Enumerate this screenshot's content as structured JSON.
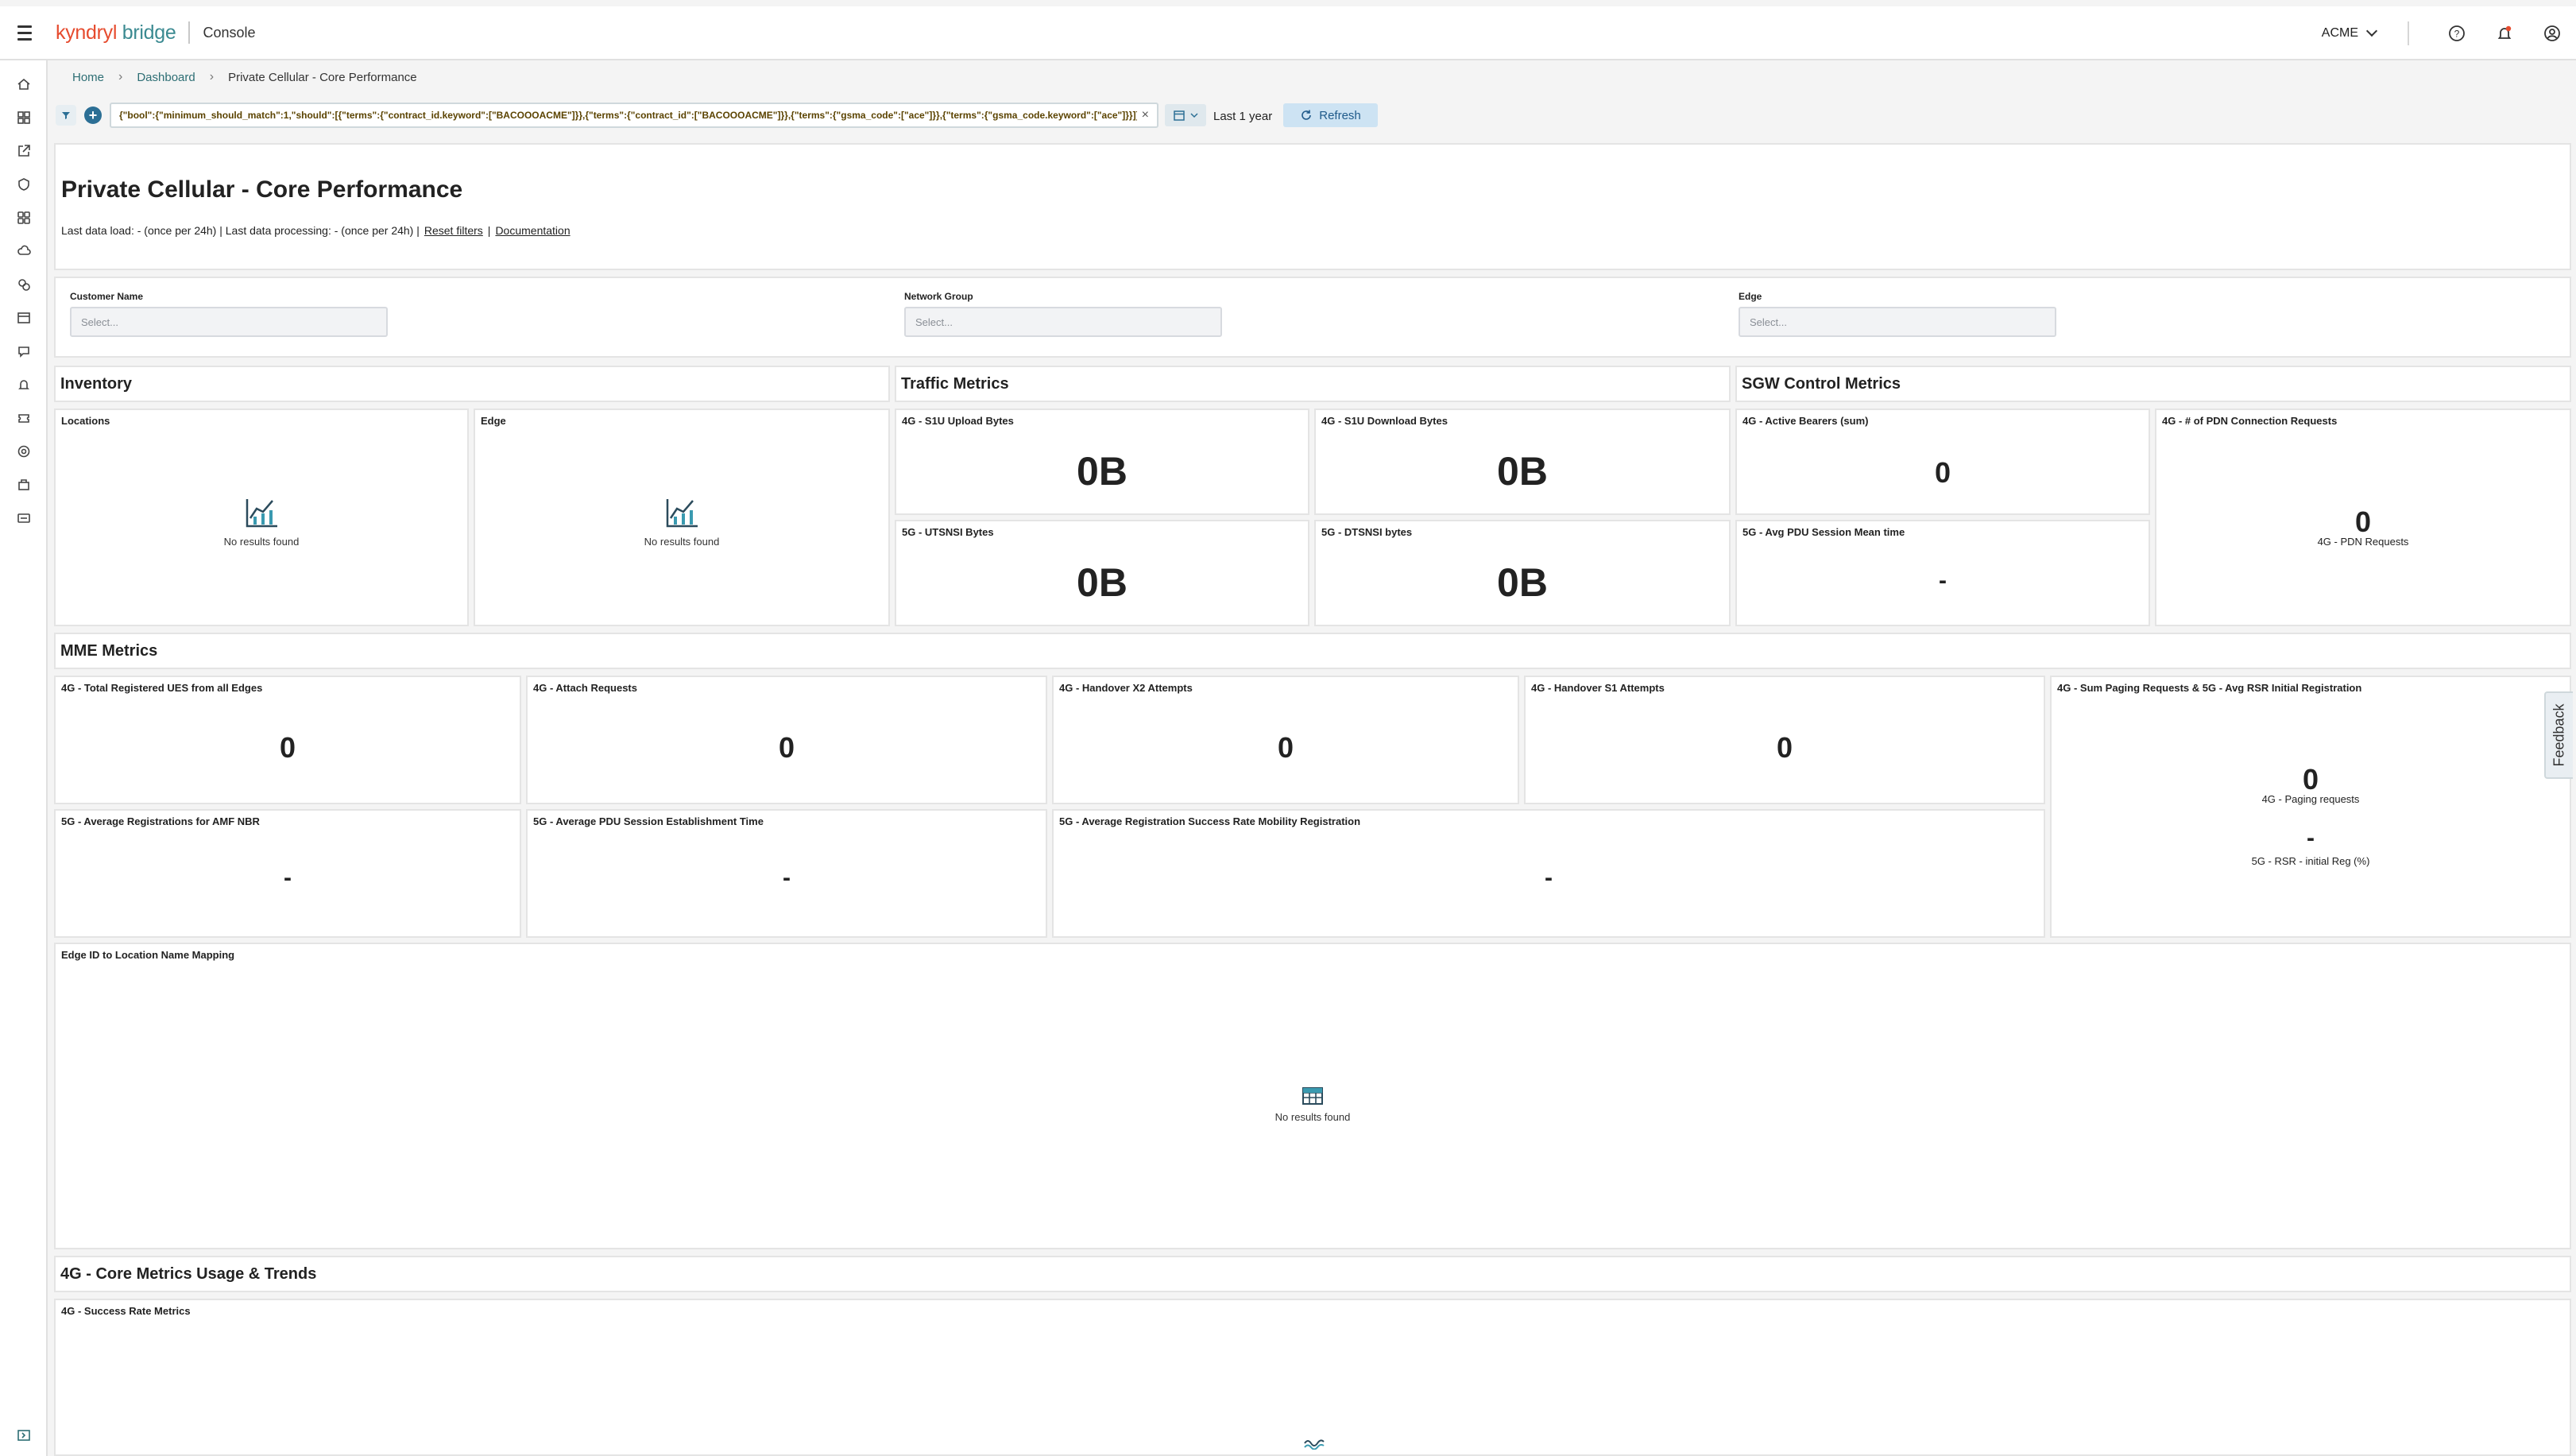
{
  "app": {
    "brand_part1": "kyndryl",
    "brand_part2": "bridge",
    "section": "Console",
    "account": "ACME",
    "colors": {
      "brand_red": "#e64b2e",
      "brand_teal": "#3b8a91",
      "link": "#2d6e74",
      "accent": "#2c6f95"
    },
    "icons": [
      "menu-icon",
      "help-icon",
      "notification-icon",
      "user-icon"
    ]
  },
  "sidebar": {
    "icons": [
      "home-icon",
      "grid-icon",
      "launch-icon",
      "shield-icon",
      "apps-icon",
      "cloud-icon",
      "services-icon",
      "catalog-icon",
      "chat-icon",
      "alert-icon",
      "ticket-icon",
      "settings-icon",
      "inventory-icon",
      "card-icon",
      "collapse-icon"
    ]
  },
  "breadcrumb": {
    "home": "Home",
    "dashboard": "Dashboard",
    "current": "Private Cellular - Core Performance"
  },
  "filter": {
    "query": "{\"bool\":{\"minimum_should_match\":1,\"should\":[{\"terms\":{\"contract_id.keyword\":[\"BACOOOACME\"]}},{\"terms\":{\"contract_id\":[\"BACOOOACME\"]}},{\"terms\":{\"gsma_code\":[\"ace\"]}},{\"terms\":{\"gsma_code.keyword\":[\"ace\"]}}]}}",
    "date_range": "Last 1 year",
    "refresh_label": "Refresh"
  },
  "header": {
    "title": "Private Cellular - Core Performance",
    "meta_text": "Last data load: - (once per 24h) | Last data processing: - (once per 24h) |",
    "reset_filters": "Reset filters",
    "sep": "|",
    "documentation": "Documentation"
  },
  "controls": [
    {
      "label": "Customer Name",
      "placeholder": "Select..."
    },
    {
      "label": "Network Group",
      "placeholder": "Select..."
    },
    {
      "label": "Edge",
      "placeholder": "Select..."
    }
  ],
  "sections": {
    "inventory": "Inventory",
    "traffic": "Traffic Metrics",
    "sgw": "SGW Control Metrics",
    "mme": "MME Metrics",
    "core4g": "4G - Core Metrics Usage & Trends"
  },
  "inventory": {
    "locations": {
      "title": "Locations",
      "empty": "No results found"
    },
    "edge": {
      "title": "Edge",
      "empty": "No results found"
    }
  },
  "traffic": {
    "s1u_upload": {
      "title": "4G - S1U Upload Bytes",
      "value": "0B"
    },
    "s1u_download": {
      "title": "4G - S1U Download Bytes",
      "value": "0B"
    },
    "utsnsi": {
      "title": "5G - UTSNSI Bytes",
      "value": "0B"
    },
    "dtsnsi": {
      "title": "5G - DTSNSI bytes",
      "value": "0B"
    }
  },
  "sgw": {
    "active_bearers": {
      "title": "4G - Active Bearers (sum)",
      "value": "0"
    },
    "avg_pdu": {
      "title": "5G - Avg PDU Session Mean time",
      "value": "-"
    },
    "pdn_requests": {
      "title": "4G - # of PDN Connection Requests",
      "value": "0",
      "sub": "4G - PDN Requests"
    }
  },
  "mme": {
    "registered_ues": {
      "title": "4G - Total Registered UES from all Edges",
      "value": "0"
    },
    "attach": {
      "title": "4G - Attach Requests",
      "value": "0"
    },
    "handover_x2": {
      "title": "4G - Handover X2 Attempts",
      "value": "0"
    },
    "handover_s1": {
      "title": "4G - Handover S1 Attempts",
      "value": "0"
    },
    "paging": {
      "title": "4G - Sum Paging Requests & 5G - Avg RSR Initial Registration",
      "value1": "0",
      "sub1": "4G - Paging requests",
      "value2": "-",
      "sub2": "5G - RSR - initial Reg (%)"
    },
    "amf_nbr": {
      "title": "5G - Average Registrations for AMF NBR",
      "value": "-"
    },
    "pdu_establish": {
      "title": "5G - Average PDU Session Establishment Time",
      "value": "-"
    },
    "mobility_reg": {
      "title": "5G - Average Registration Success Rate Mobility Registration",
      "value": "-"
    }
  },
  "mapping": {
    "title": "Edge ID to Location Name Mapping",
    "empty": "No results found"
  },
  "success_rate": {
    "title": "4G - Success Rate Metrics"
  },
  "feedback": "Feedback"
}
